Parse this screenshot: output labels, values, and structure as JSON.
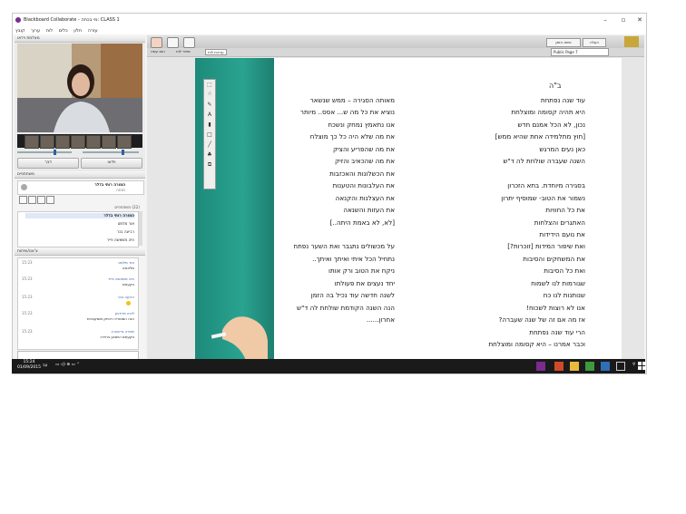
{
  "window": {
    "title": "Blackboard Collaborate - מי בכתה: CLASS 1"
  },
  "menubar": [
    "עזרה",
    "חלון",
    "כלים",
    "לוח",
    "ערוך",
    "קובץ"
  ],
  "left": {
    "video_header": "מצלמת וידאו",
    "talk_label": "דבר",
    "video_label": "וידאו",
    "participants_header": "משתתפים",
    "moderator_name": "המורה רותי בדלר",
    "moderator_sub": "מנחה",
    "participants_count": "(22) משתתפים",
    "participants": [
      "המורה רותי בדלר",
      "אור מלמט",
      "רביעה בכר",
      "חיה משאשה פייר"
    ],
    "chat_header": "צ'אט/שיחות",
    "chat": [
      {
        "name": "אור מלמט",
        "time": "15:23",
        "text": "מלאאא"
      },
      {
        "name": "חיה משאשה פייר",
        "time": "15:23",
        "text": "בקעאם"
      },
      {
        "name": "רביעה בכר",
        "time": "15:23",
        "text": ""
      },
      {
        "name": "ליבה פרידמן",
        "time": "15:23",
        "text": "הנה הסטוריה רוניתן מוסקוביות"
      },
      {
        "name": "שחרה גרינבורג",
        "time": "15:23",
        "text": "בקעאם השבוע בחירה"
      }
    ],
    "chat_tabs": [
      "צ'אט",
      "פרטים"
    ]
  },
  "main": {
    "toolbar_right": [
      "העלה",
      "נושא הזמן"
    ],
    "page_select": "Public Page 7",
    "sub_left": [
      "הצג עשה",
      "מתיר לוח",
      "עריכת לוח"
    ],
    "slide_title": "ב\"ה",
    "poem_right": [
      "עוד שנה נפתחת",
      "היא תהיה קסומה ומוצלחת",
      "נכון, לא הכל אמנם חדש",
      "[חוץ מתלמידה אחת שהיא ממש]",
      "כאן נעים המרגש",
      "השנה שעברה שולחת לה ד\"ש",
      "",
      "בסגירה מיוחדת. בתא הזכרון",
      "נשמור את הטוב- שמוסיף יתרון",
      "את כל החוויות",
      "האתגרים והצלחות",
      "את נועם הידידות",
      "ואת שיפור המידות [זוכרות?]",
      "את המשחקים והסיבות",
      "ואת כל הסיבות",
      "שגורמות לנו לשמוח",
      "שנותנות לנו כח",
      "אנו לא רוצות לשכוח!",
      "אז מה אם זה של שנה שעברה?",
      "הרי עוד שנה נפתחת",
      "וכבר אמרנו – היא קסומה ומוצלחת"
    ],
    "poem_left": [
      "מאותה הסגירה – ממש שנשאר",
      "נוציא את כל מה ש... אסס.. מיותר",
      "אנו נתאמץ נמחק ונשכח",
      "את מה שלא היה כל כך מוצלח",
      "את מה שהפריע והציק",
      "את מה שהכאיב והזיק",
      "את הכשלונות והאכזבות",
      "את העלבונות והטענות",
      "את העצלנות והקנאה",
      "את העזות והשנאה",
      "[לא, לא באמת היתה..]",
      "",
      "על מכשולים נתגבר ואת השער נפתח",
      "נתחיל הכל איתי ואיתך ואיתך..",
      "ניקח את הטוב ורק אותו",
      "יחד נעצים את פעולתו",
      "לשנה חדשה עוד נכיל בה הזמן",
      "הנה השנה הקודמת שולחת לה ד\"ש",
      "אחרון......"
    ]
  },
  "taskbar": {
    "time": "15:24",
    "date": "01/09/2015",
    "lang": "עב"
  }
}
